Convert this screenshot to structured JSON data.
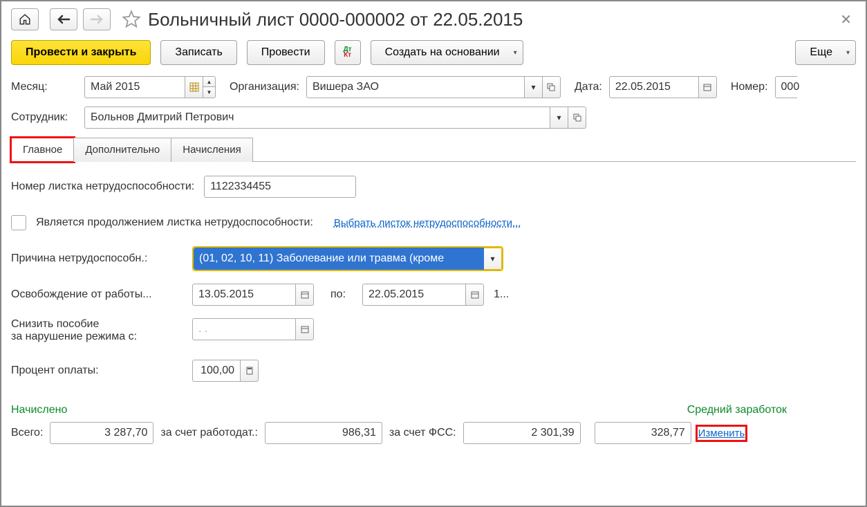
{
  "title": "Больничный лист 0000-000002 от 22.05.2015",
  "toolbar": {
    "post_close": "Провести и закрыть",
    "save": "Записать",
    "post": "Провести",
    "create_based": "Создать на основании",
    "more": "Еще"
  },
  "fields": {
    "month_label": "Месяц:",
    "month_value": "Май 2015",
    "org_label": "Организация:",
    "org_value": "Вишера ЗАО",
    "date_label": "Дата:",
    "date_value": "22.05.2015",
    "number_label": "Номер:",
    "number_value": "000",
    "employee_label": "Сотрудник:",
    "employee_value": "Больнов Дмитрий Петрович"
  },
  "tabs": {
    "main": "Главное",
    "additional": "Дополнительно",
    "accruals": "Начисления"
  },
  "main_tab": {
    "sheet_number_label": "Номер листка нетрудоспособности:",
    "sheet_number_value": "1122334455",
    "is_continuation_label": "Является продолжением листка нетрудоспособности:",
    "select_sheet_link": "Выбрать листок нетрудоспособности...",
    "reason_label": "Причина нетрудоспособн.:",
    "reason_value": "(01, 02, 10, 11) Заболевание или травма (кроме",
    "release_label": "Освобождение от работы...",
    "release_from": "13.05.2015",
    "release_to_label": "по:",
    "release_to": "22.05.2015",
    "release_suffix": "1...",
    "reduce_label_1": "Снизить пособие",
    "reduce_label_2": "за нарушение режима с:",
    "reduce_value": "  .  .",
    "percent_label": "Процент оплаты:",
    "percent_value": "100,00"
  },
  "footer": {
    "accrued_label": "Начислено",
    "avg_label": "Средний заработок",
    "total_label": "Всего:",
    "total_value": "3 287,70",
    "employer_label": "за счет работодат.:",
    "employer_value": "986,31",
    "fss_label": "за счет ФСС:",
    "fss_value": "2 301,39",
    "avg_value": "328,77",
    "change_link": "Изменить"
  }
}
